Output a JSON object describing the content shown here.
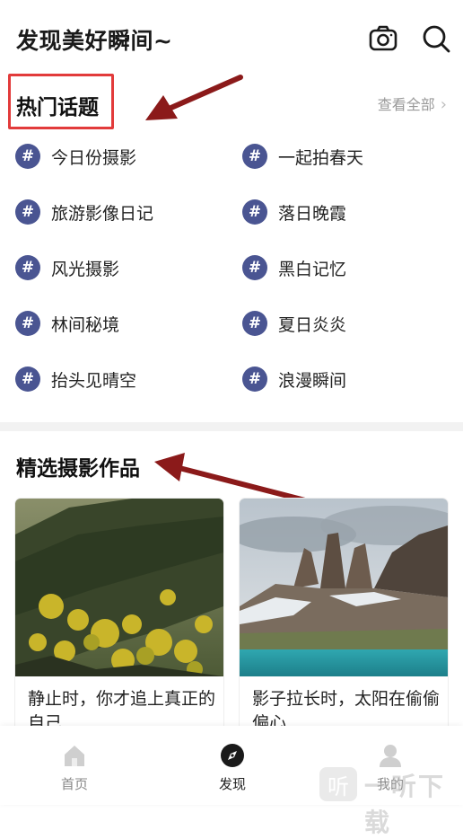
{
  "header": {
    "title": "发现美好瞬间~",
    "camera_icon": "camera-icon",
    "search_icon": "search-icon"
  },
  "topics_section": {
    "title": "热门话题",
    "view_all": "查看全部",
    "hash_symbol": "#",
    "items": [
      {
        "label": "今日份摄影"
      },
      {
        "label": "一起拍春天"
      },
      {
        "label": "旅游影像日记"
      },
      {
        "label": "落日晚霞"
      },
      {
        "label": "风光摄影"
      },
      {
        "label": "黑白记忆"
      },
      {
        "label": "林间秘境"
      },
      {
        "label": "夏日炎炎"
      },
      {
        "label": "抬头见晴空"
      },
      {
        "label": "浪漫瞬间"
      }
    ]
  },
  "works_section": {
    "title": "精选摄影作品",
    "cards": [
      {
        "caption": "静止时，你才追上真正的自己"
      },
      {
        "caption": "影子拉长时，太阳在偷偷偏心"
      }
    ]
  },
  "tabbar": {
    "tabs": [
      {
        "label": "首页",
        "icon": "home-icon",
        "active": false
      },
      {
        "label": "发现",
        "icon": "compass-icon",
        "active": true
      },
      {
        "label": "我的",
        "icon": "user-icon",
        "active": false
      }
    ]
  },
  "watermark": {
    "logo_char": "听",
    "text": "一听下载"
  },
  "colors": {
    "hash_badge": "#4a5592",
    "highlight_box": "#e23b3b",
    "arrow": "#8b1a1a",
    "divider": "#f2f2f2"
  }
}
